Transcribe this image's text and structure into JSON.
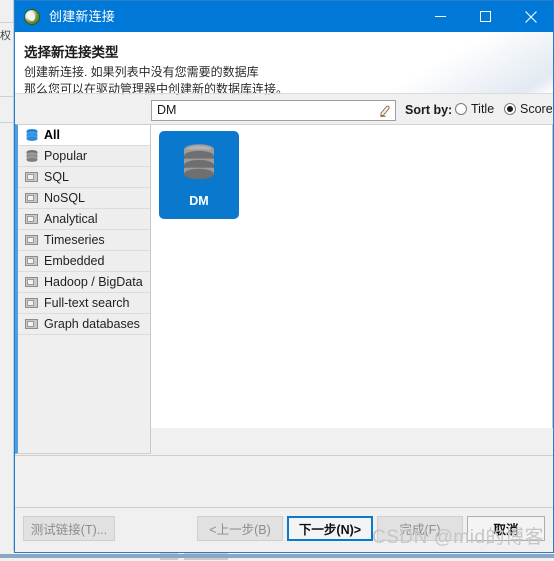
{
  "window": {
    "title": "创建新连接",
    "app_icon": "dbeaver-app-icon",
    "controls": {
      "minimize": "minimize-icon",
      "maximize": "maximize-icon",
      "close": "close-icon"
    }
  },
  "header": {
    "title": "选择新连接类型",
    "description_line1": "创建新连接. 如果列表中没有您需要的数据库",
    "description_line2": "那么您可以在驱动管理器中创建新的数据库连接。"
  },
  "search": {
    "value": "DM",
    "placeholder": "",
    "clear_icon": "eraser-icon"
  },
  "sort": {
    "label": "Sort by:",
    "options": [
      {
        "label": "Title",
        "selected": false
      },
      {
        "label": "Score",
        "selected": true
      }
    ]
  },
  "sidebar": {
    "items": [
      {
        "label": "All",
        "icon": "database-stack-icon",
        "selected": true
      },
      {
        "label": "Popular",
        "icon": "database-stack-icon",
        "selected": false
      },
      {
        "label": "SQL",
        "icon": "folder-icon",
        "selected": false
      },
      {
        "label": "NoSQL",
        "icon": "folder-icon",
        "selected": false
      },
      {
        "label": "Analytical",
        "icon": "folder-icon",
        "selected": false
      },
      {
        "label": "Timeseries",
        "icon": "folder-icon",
        "selected": false
      },
      {
        "label": "Embedded",
        "icon": "folder-icon",
        "selected": false
      },
      {
        "label": "Hadoop / BigData",
        "icon": "folder-icon",
        "selected": false
      },
      {
        "label": "Full-text search",
        "icon": "folder-icon",
        "selected": false
      },
      {
        "label": "Graph databases",
        "icon": "folder-icon",
        "selected": false
      }
    ]
  },
  "content": {
    "drivers": [
      {
        "label": "DM",
        "icon": "database-cylinder-icon",
        "selected": true
      }
    ]
  },
  "footer": {
    "buttons": [
      {
        "name": "test-connection",
        "label": "测试链接(T)...",
        "state": "disabled"
      },
      {
        "name": "back",
        "label": "<上一步(B)",
        "state": "disabled"
      },
      {
        "name": "next",
        "label": "下一步(N)>",
        "state": "focused"
      },
      {
        "name": "finish",
        "label": "完成(F)",
        "state": "disabled"
      },
      {
        "name": "cancel",
        "label": "取消",
        "state": "enabled"
      }
    ]
  },
  "watermark": {
    "text": "CSDN @mid的博客"
  },
  "colors": {
    "titlebar": "#0078d7",
    "accent": "#0a78cd",
    "dialog_border": "#2a7cc7",
    "sidebar_accent": "#4da0e0",
    "panel_bg": "#f0f0f0"
  }
}
